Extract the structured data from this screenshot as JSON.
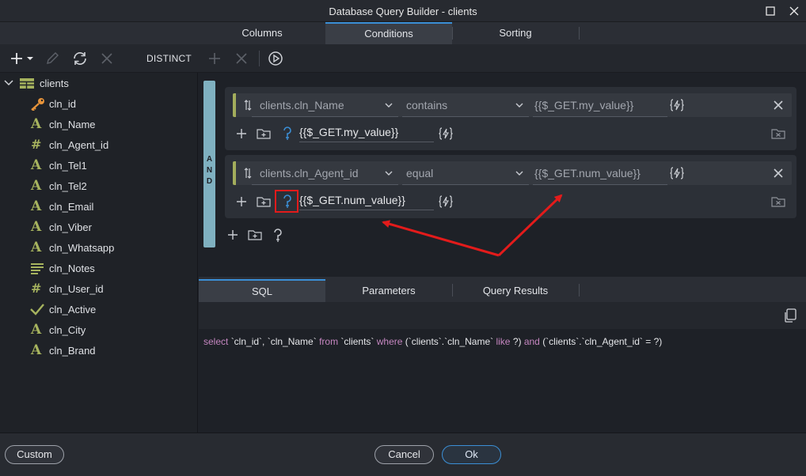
{
  "window": {
    "title": "Database Query Builder - clients"
  },
  "top_tabs": [
    {
      "label": "Columns"
    },
    {
      "label": "Conditions"
    },
    {
      "label": "Sorting"
    }
  ],
  "toolbar": {
    "distinct_label": "DISTINCT"
  },
  "tree": {
    "table": "clients",
    "columns": [
      {
        "name": "cln_id",
        "type": "key-icon"
      },
      {
        "name": "cln_Name",
        "type": "text-icon"
      },
      {
        "name": "cln_Agent_id",
        "type": "number-icon"
      },
      {
        "name": "cln_Tel1",
        "type": "text-icon"
      },
      {
        "name": "cln_Tel2",
        "type": "text-icon"
      },
      {
        "name": "cln_Email",
        "type": "text-icon"
      },
      {
        "name": "cln_Viber",
        "type": "text-icon"
      },
      {
        "name": "cln_Whatsapp",
        "type": "text-icon"
      },
      {
        "name": "cln_Notes",
        "type": "multiline-text-icon"
      },
      {
        "name": "cln_User_id",
        "type": "number-icon"
      },
      {
        "name": "cln_Active",
        "type": "checkmark-icon"
      },
      {
        "name": "cln_City",
        "type": "text-icon"
      },
      {
        "name": "cln_Brand",
        "type": "text-icon"
      }
    ]
  },
  "conditions": {
    "logic": [
      "A",
      "N",
      "D"
    ],
    "groups": [
      {
        "field": "clients.cln_Name",
        "operator": "contains",
        "value": "{{$_GET.my_value}}",
        "parameter": "{{$_GET.my_value}}"
      },
      {
        "field": "clients.cln_Agent_id",
        "operator": "equal",
        "value": "{{$_GET.num_value}}",
        "parameter": "{{$_GET.num_value}}"
      }
    ]
  },
  "bottom_tabs": [
    {
      "label": "SQL"
    },
    {
      "label": "Parameters"
    },
    {
      "label": "Query Results"
    }
  ],
  "sql": {
    "parts": [
      {
        "kind": "kw",
        "text": "select "
      },
      {
        "kind": "id",
        "text": "`cln_id`, `cln_Name` "
      },
      {
        "kind": "kw",
        "text": "from "
      },
      {
        "kind": "id",
        "text": "`clients` "
      },
      {
        "kind": "kw",
        "text": "where "
      },
      {
        "kind": "id",
        "text": "(`clients`.`cln_Name` "
      },
      {
        "kind": "kw",
        "text": "like "
      },
      {
        "kind": "id",
        "text": "?) "
      },
      {
        "kind": "kw",
        "text": "and "
      },
      {
        "kind": "id",
        "text": "(`clients`.`cln_Agent_id` = ?)"
      }
    ]
  },
  "footer": {
    "custom_label": "Custom",
    "cancel_label": "Cancel",
    "ok_label": "Ok"
  },
  "colors": {
    "accent": "#3b8fd6",
    "type_icon": "#a6b35e",
    "annotation_red": "#e31b1b",
    "sql_keyword": "#c586c0"
  }
}
